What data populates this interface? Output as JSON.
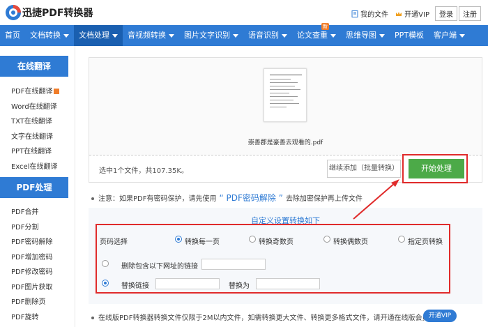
{
  "header": {
    "brand": "迅捷PDF转换器",
    "my_files": "我的文件",
    "open_vip": "开通VIP",
    "login": "登录",
    "register": "注册"
  },
  "nav": {
    "items": [
      {
        "label": "首页",
        "caret": false
      },
      {
        "label": "文档转换",
        "caret": true
      },
      {
        "label": "文档处理",
        "caret": true,
        "active": true
      },
      {
        "label": "音视频转换",
        "caret": true
      },
      {
        "label": "图片文字识别",
        "caret": true
      },
      {
        "label": "语音识别",
        "caret": true
      },
      {
        "label": "论文查重",
        "caret": true,
        "badge": "新"
      },
      {
        "label": "思维导图",
        "caret": true
      },
      {
        "label": "PPT模板",
        "caret": false
      },
      {
        "label": "客户端",
        "caret": true
      }
    ]
  },
  "sidebar": {
    "section1": "在线翻译",
    "translate_items": [
      "PDF在线翻译",
      "Word在线翻译",
      "TXT在线翻译",
      "文字在线翻译",
      "PPT在线翻译",
      "Excel在线翻译"
    ],
    "section2": "PDF处理",
    "pdf_items": [
      "PDF合并",
      "PDF分割",
      "PDF密码解除",
      "PDF增加密码",
      "PDF修改密码",
      "PDF图片获取",
      "PDF删除页",
      "PDF旋转"
    ]
  },
  "upload": {
    "file_name": "崇善郡是豪善去观看的.pdf",
    "selected_info": "选中1个文件，共107.35K。",
    "add_button": "继续添加（批量转换）",
    "start_button": "开始处理"
  },
  "notice": {
    "prefix": "注意：如果PDF有密码保护，请先使用",
    "link": "“ PDF密码解除 ”",
    "suffix": "去除加密保护再上传文件"
  },
  "options": {
    "title": "自定义设置转换如下",
    "page_select_label": "页码选择",
    "page_modes": [
      "转换每一页",
      "转换奇数页",
      "转换偶数页",
      "指定页转换"
    ],
    "selected_mode": 0,
    "delete_links_label": "删除包含以下网址的链接",
    "replace_link_label": "替换链接",
    "replace_with_label": "替换为",
    "delete_links_value": "",
    "replace_link_value": "",
    "replace_with_value": ""
  },
  "bottom": {
    "note": "在线版PDF转换器转换文件仅限于2M以内文件，如需转换更大文件、转换更多格式文件，请开通在线版会员。",
    "vip_button": "开通VIP"
  },
  "colors": {
    "primary": "#2f7bd4",
    "nav_active": "#1a5fb0",
    "start_green": "#4caa48",
    "highlight_red": "#e02b2b",
    "hot_orange": "#f07d2a"
  }
}
